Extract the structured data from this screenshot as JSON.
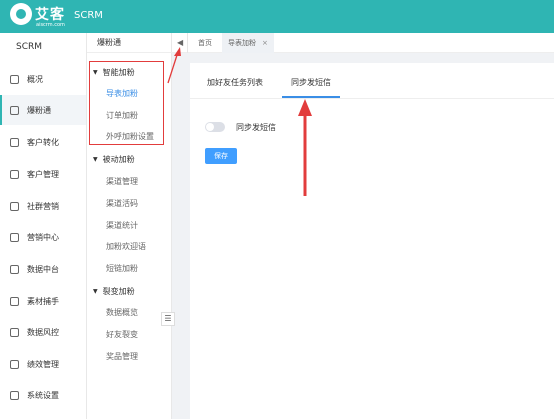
{
  "header": {
    "logo_text": "艾客",
    "logo_sub": "aiscrm.com",
    "app_title": "SCRM"
  },
  "sidebar": {
    "title": "SCRM",
    "items": [
      {
        "label": "概况",
        "icon": "home-icon"
      },
      {
        "label": "爆粉通",
        "icon": "user-icon",
        "active": true
      },
      {
        "label": "客户转化",
        "icon": "convert-icon"
      },
      {
        "label": "客户管理",
        "icon": "customers-icon"
      },
      {
        "label": "社群营销",
        "icon": "group-icon"
      },
      {
        "label": "营销中心",
        "icon": "marketing-icon"
      },
      {
        "label": "数据中台",
        "icon": "data-icon"
      },
      {
        "label": "素材捕手",
        "icon": "material-icon"
      },
      {
        "label": "数据风控",
        "icon": "shield-icon"
      },
      {
        "label": "绩效管理",
        "icon": "performance-icon"
      },
      {
        "label": "系统设置",
        "icon": "gear-icon"
      }
    ]
  },
  "submenu": {
    "title": "爆粉通",
    "groups": [
      {
        "label": "智能加粉",
        "items": [
          "导表加粉",
          "订单加粉",
          "外呼加粉设置"
        ]
      },
      {
        "label": "被动加粉",
        "items": [
          "渠道管理",
          "渠道活码",
          "渠道统计",
          "加粉欢迎语",
          "短链加粉"
        ]
      },
      {
        "label": "裂变加粉",
        "items": [
          "数据概览",
          "好友裂变",
          "奖品管理"
        ]
      }
    ]
  },
  "tabs": {
    "home": "首页",
    "current": "导表加粉",
    "close": "×"
  },
  "content": {
    "tabs": [
      "加好友任务列表",
      "同步发短信"
    ],
    "toggle_label": "同步发短信",
    "save_label": "保存"
  },
  "colors": {
    "header": "#2fb5b3",
    "accent": "#3a8ee6",
    "button": "#409eff",
    "annotation": "#e23c3c"
  }
}
